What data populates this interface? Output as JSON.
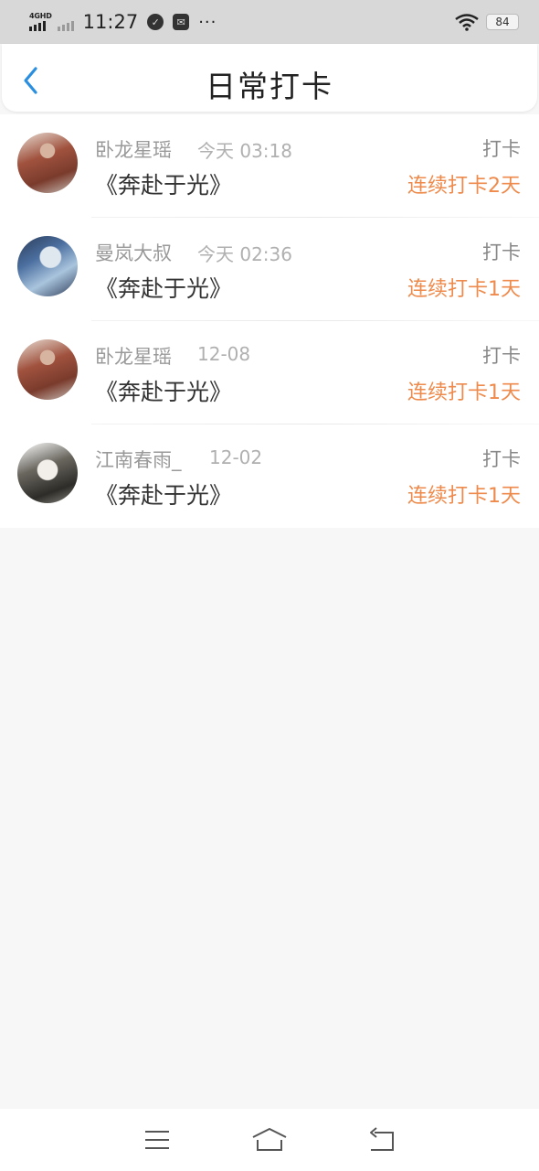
{
  "status_bar": {
    "network": "4GHD",
    "time": "11:27",
    "battery": "84"
  },
  "header": {
    "title": "日常打卡"
  },
  "checkins": [
    {
      "name": "卧龙星瑶",
      "time": "今天 03:18",
      "action": "打卡",
      "book": "《奔赴于光》",
      "streak": "连续打卡2天"
    },
    {
      "name": "曼岚大叔",
      "time": "今天 02:36",
      "action": "打卡",
      "book": "《奔赴于光》",
      "streak": "连续打卡1天"
    },
    {
      "name": "卧龙星瑶",
      "time": "12-08",
      "action": "打卡",
      "book": "《奔赴于光》",
      "streak": "连续打卡1天"
    },
    {
      "name": "江南春雨_",
      "time": "12-02",
      "action": "打卡",
      "book": "《奔赴于光》",
      "streak": "连续打卡1天"
    }
  ],
  "icons": {
    "back": "chevron-left-icon",
    "menu": "menu-icon",
    "home": "home-icon",
    "back_nav": "return-icon"
  },
  "colors": {
    "accent": "#2b8fe0",
    "streak": "#ee8a4b"
  }
}
